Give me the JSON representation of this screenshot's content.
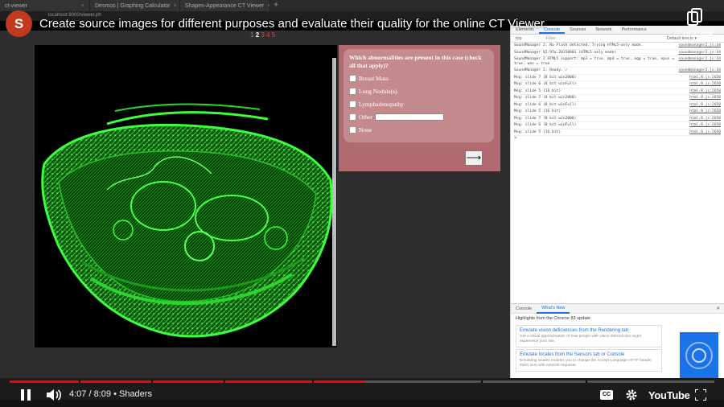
{
  "browser": {
    "tabs": [
      {
        "label": "ct-viewer"
      },
      {
        "label": "Desmos | Graphing Calculator"
      },
      {
        "label": "Shapes-Appearance CT Viewer"
      }
    ],
    "address": "localhost:8000/viewer.ph"
  },
  "video": {
    "channel_initial": "S",
    "title": "Create source images for different purposes and evaluate their quality for the online CT Viewer.",
    "copy_link_label": "Copy link"
  },
  "page": {
    "pagination": {
      "prev": "1",
      "current": "2",
      "next": "3 4 5"
    },
    "question": {
      "prompt": "Which abnormalities are present in this case (check all that apply)?",
      "options": [
        "Breast Mass",
        "Lung Nodule(s)",
        "Lymphadenopathy",
        "Other",
        "None"
      ],
      "next_arrow": "⟶"
    }
  },
  "devtools": {
    "tabs": [
      "Elements",
      "Console",
      "Sources",
      "Network",
      "Performance"
    ],
    "toolbar": {
      "context": "top",
      "filter": "Filter",
      "levels": "Default levels ▾"
    },
    "console": [
      {
        "msg": "SoundManager 2: No Flash detected. Trying HTML5-only mode.",
        "src": "soundmanager2.js:34"
      },
      {
        "msg": "SoundManager V2.97a.20150601 (HTML5-only mode)",
        "src": "soundmanager2.js:34"
      },
      {
        "msg": "SoundManager 2 HTML5 support: mp3 = true, mp4 = true, ogg = true, opus = true, wav = true",
        "src": "soundmanager2.js:34"
      },
      {
        "msg": "SoundManager 2: Ready. ✓",
        "src": "soundmanager2.js:34"
      },
      {
        "msg": "Msg: slide 7 (8 bit win2000)",
        "src": "html.8.js:2650"
      },
      {
        "msg": "Msg: slide 6 (8 bit winFull)",
        "src": "html.8.js:2650"
      },
      {
        "msg": "Msg: slide 5 (16 bit)",
        "src": "html.8.js:2650"
      },
      {
        "msg": "Msg: slide 7 (8 bit win2000)",
        "src": "html.8.js:2650"
      },
      {
        "msg": "Msg: slide 6 (8 bit winFull)",
        "src": "html.8.js:2650"
      },
      {
        "msg": "Msg: slide 5 (16 bit)",
        "src": "html.8.js:2650"
      },
      {
        "msg": "Msg: slide 7 (8 bit win2000)",
        "src": "html.8.js:2650"
      },
      {
        "msg": "Msg: slide 6 (8 bit winFull)",
        "src": "html.8.js:2650"
      },
      {
        "msg": "Msg: slide 5 (16 bit)",
        "src": "html.8.js:2650"
      }
    ],
    "prompt": ">",
    "drawer": {
      "tabs": [
        "Console",
        "What's New"
      ],
      "heading": "Highlights from the Chrome 83 update",
      "cards": [
        {
          "title": "Emulate vision deficiencies from the Rendering tab",
          "desc": "Get a visual approximation of how people with vision deficiencies might experience your site."
        },
        {
          "title": "Emulate locales from the Sensors tab or Console",
          "desc": "Emulating locales enables you to change the Accept-Language HTTP header that's sent with network requests."
        }
      ]
    }
  },
  "player": {
    "time_current": "4:07",
    "time_total": "8:09",
    "chapter": "Shaders",
    "progress_fraction": 0.505,
    "cc_label": "CC",
    "logo": "YouTube"
  }
}
